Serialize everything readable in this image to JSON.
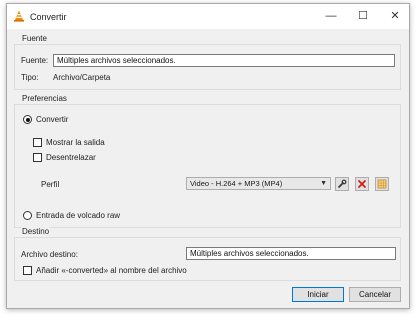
{
  "window": {
    "title": "Convertir"
  },
  "titlebar": {
    "minimize": "—",
    "maximize": "☐",
    "close": "✕"
  },
  "source": {
    "group_title": "Fuente",
    "source_label": "Fuente:",
    "source_value": "Múltiples archivos seleccionados.",
    "type_label": "Tipo:",
    "type_value": "Archivo/Carpeta"
  },
  "preferences": {
    "group_title": "Preferencias",
    "convert_label": "Convertir",
    "convert_selected": true,
    "show_output_label": "Mostrar la salida",
    "deinterlace_label": "Desentrelazar",
    "profile_label": "Perfil",
    "profile_value": "Video - H.264 + MP3 (MP4)",
    "raw_dump_label": "Entrada de volcado raw",
    "raw_dump_selected": false
  },
  "destination": {
    "group_title": "Destino",
    "dest_file_label": "Archivo destino:",
    "dest_file_value": "Múltiples archivos seleccionados.",
    "append_label": "Añadir «-converted» al nombre del archivo"
  },
  "buttons": {
    "start": "Iniciar",
    "cancel": "Cancelar"
  }
}
